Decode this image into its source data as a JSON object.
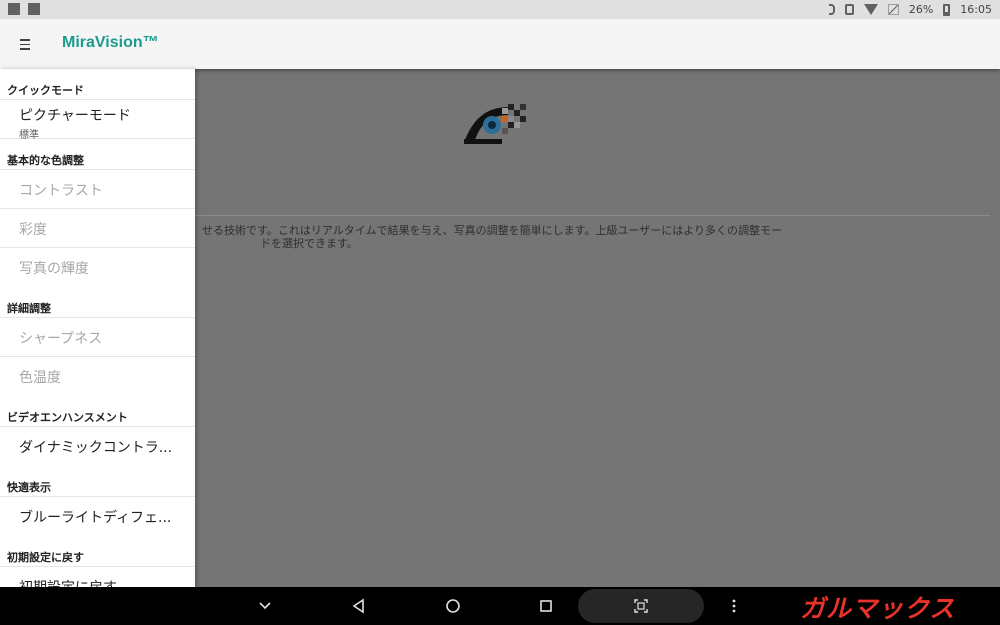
{
  "status_bar": {
    "left_icons": [
      "map-pin-icon",
      "image-icon"
    ],
    "battery_percent": "26%",
    "time": "16:05",
    "right_icons": [
      "bluetooth-icon",
      "vibrate-icon",
      "wifi-icon",
      "no-signal-icon",
      "battery-icon"
    ]
  },
  "app_bar": {
    "menu_icon": "hamburger-menu-icon",
    "title": "MiraVision™",
    "accent_color": "#1a9b8e"
  },
  "main": {
    "logo_icon": "miravision-eye-icon",
    "description_line1": "せる技術です。これはリアルタイムで結果を与え、写真の調整を簡単にします。上級ユーザーにはより多くの調整モー",
    "description_line2": "ドを選択できます。"
  },
  "drawer": {
    "section_quick": "クイックモード",
    "picture_mode_label": "ピクチャーモード",
    "picture_mode_value": "標準",
    "section_basic": "基本的な色調整",
    "contrast": "コントラスト",
    "saturation": "彩度",
    "photo_brightness": "写真の輝度",
    "section_detail": "詳細調整",
    "sharpness": "シャープネス",
    "color_temperature": "色温度",
    "section_video": "ビデオエンハンスメント",
    "dynamic_contrast": "ダイナミックコントラ...",
    "section_comfort": "快適表示",
    "blue_light": "ブルーライトディフェ...",
    "section_reset": "初期設定に戻す",
    "reset_item": "初期設定に戻す"
  },
  "nav_bar": {
    "icons": [
      "chevron-down-icon",
      "back-icon",
      "home-icon",
      "recents-icon",
      "screenshot-icon",
      "more-vert-icon"
    ],
    "watermark": "ガルマックス"
  },
  "colors": {
    "drawer_bg": "#ffffff",
    "scrim": "#757575",
    "disabled_text": "#a8a8a8",
    "watermark": "#e8332a"
  }
}
